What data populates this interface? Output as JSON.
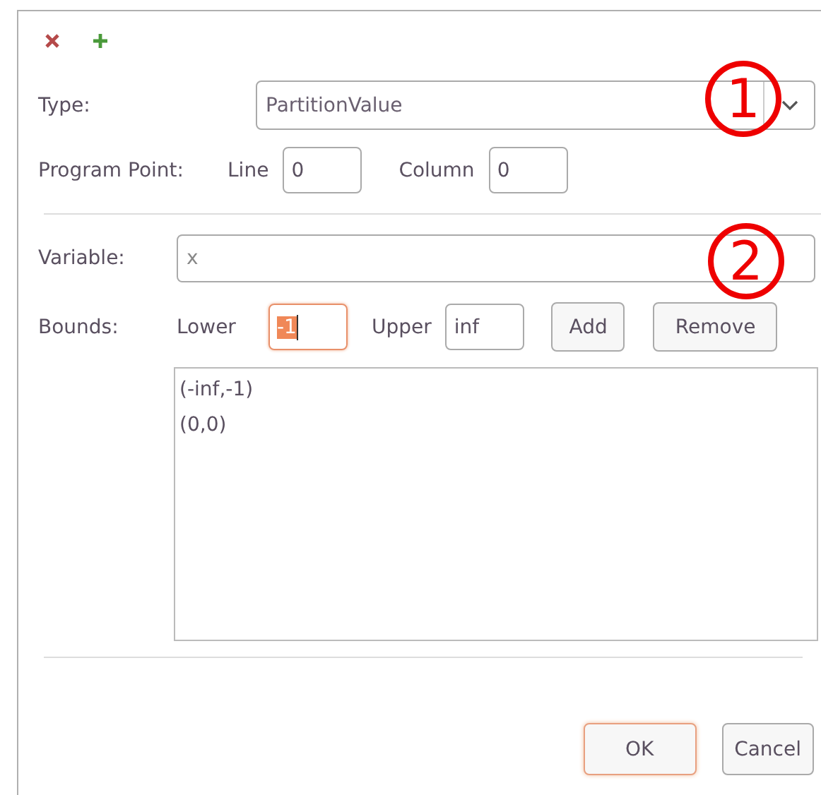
{
  "toolbar": [
    {
      "kind": "remove"
    },
    {
      "kind": "add"
    }
  ],
  "type": {
    "label": "Type:",
    "value": "PartitionValue"
  },
  "program_point": {
    "label": "Program Point:",
    "line_label": "Line",
    "line_value": "0",
    "column_label": "Column",
    "column_value": "0"
  },
  "variable": {
    "label": "Variable:",
    "value": "x"
  },
  "bounds": {
    "label": "Bounds:",
    "lower_label": "Lower",
    "lower_value": "-1",
    "lower_focused": true,
    "upper_label": "Upper",
    "upper_value": "inf",
    "buttons": [
      "Add",
      "Remove"
    ],
    "items": [
      "(-inf,-1)",
      "(0,0)"
    ]
  },
  "buttons": [
    {
      "label": "OK",
      "default": true
    },
    {
      "label": "Cancel",
      "default": false
    }
  ],
  "annotations": [
    "1",
    "2"
  ]
}
